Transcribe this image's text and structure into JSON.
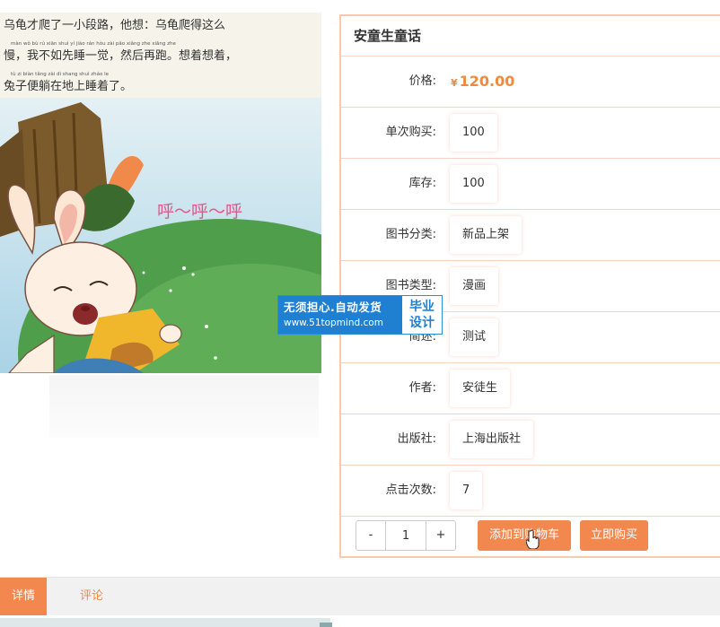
{
  "illustration": {
    "story_lines": [
      "乌龟才爬了一小段路，他想：乌龟爬得这么",
      "慢，我不如先睡一觉，然后再跑。想着想着，",
      "兔子便躺在地上睡着了。"
    ],
    "pinyin_lines": [
      "màn  wǒ  bù  rú  xiān  shuì  yí  jiào    rán  hòu  zài  pǎo    xiǎng zhe xiǎng zhe",
      "tù   zi  biàn tǎng zài  dì  shang shuì  zháo  le"
    ],
    "sound_text": "呼～呼～呼"
  },
  "product": {
    "title": "安童生童话",
    "price_label": "价格:",
    "price_currency": "¥",
    "price_value": "120.00",
    "fields": [
      {
        "label": "单次购买:",
        "value": "100"
      },
      {
        "label": "库存:",
        "value": "100"
      },
      {
        "label": "图书分类:",
        "value": "新品上架"
      },
      {
        "label": "图书类型:",
        "value": "漫画"
      },
      {
        "label": "简述:",
        "value": "测试"
      },
      {
        "label": "作者:",
        "value": "安徒生"
      },
      {
        "label": "出版社:",
        "value": "上海出版社"
      },
      {
        "label": "点击次数:",
        "value": "7"
      }
    ],
    "quantity": {
      "minus": "-",
      "value": "1",
      "plus": "+"
    },
    "add_to_cart": "添加到购物车",
    "buy_now": "立即购买"
  },
  "watermark": {
    "line1": "无须担心.自动发货",
    "line2": "www.51topmind.com",
    "side_top": "毕业",
    "side_bottom": "设计"
  },
  "tabs": {
    "detail": "详情",
    "comment": "评论"
  },
  "colors": {
    "accent": "#f3884f",
    "price": "#f08a3c",
    "panel_border": "#f8c9ad",
    "watermark_blue": "#1f7fd0"
  }
}
